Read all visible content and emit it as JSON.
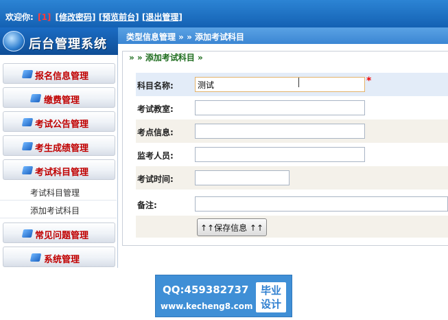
{
  "topbar": {
    "welcome": "欢迎你:",
    "username": "[1]",
    "links": [
      "[修改密码]",
      "[预览前台]",
      "[退出管理]"
    ]
  },
  "logo": {
    "title": "后台管理系统"
  },
  "breadcrumb": {
    "text": "类型信息管理 » » 添加考试科目"
  },
  "sidebar": {
    "menus": [
      {
        "label": "报名信息管理",
        "icon": "folder-icon"
      },
      {
        "label": "缴费管理",
        "icon": "folder-icon"
      },
      {
        "label": "考试公告管理",
        "icon": "folder-icon"
      },
      {
        "label": "考生成绩管理",
        "icon": "folder-icon"
      },
      {
        "label": "考试科目管理",
        "icon": "folder-icon"
      },
      {
        "label": "常见问题管理",
        "icon": "folder-icon"
      },
      {
        "label": "系统管理",
        "icon": "folder-icon"
      }
    ],
    "subitems": [
      "考试科目管理",
      "添加考试科目"
    ]
  },
  "form": {
    "legend": "» » 添加考试科目 »",
    "fields": [
      {
        "label": "科目名称:",
        "value": "测试",
        "required": "*"
      },
      {
        "label": "考试教室:",
        "value": ""
      },
      {
        "label": "考点信息:",
        "value": ""
      },
      {
        "label": "监考人员:",
        "value": ""
      },
      {
        "label": "考试时间:",
        "value": ""
      },
      {
        "label": "备注:",
        "value": ""
      }
    ],
    "save_label": "↑↑保存信息 ↑↑"
  },
  "watermark": {
    "qq": "QQ:459382737",
    "url": "www.kecheng8.com",
    "badge_line1": "毕业",
    "badge_line2": "设计"
  },
  "colors": {
    "header": "#1461b3",
    "menu_text": "#c00000",
    "legend_text": "#1c6b1c",
    "required": "#e00000"
  }
}
